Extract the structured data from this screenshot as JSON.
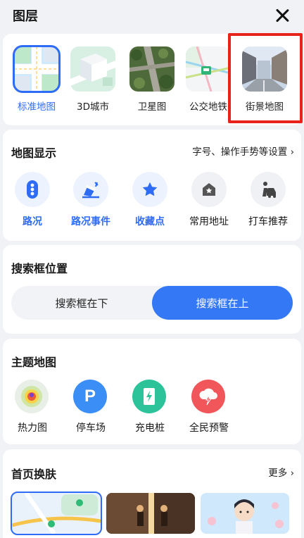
{
  "header": {
    "title": "图层"
  },
  "layers": [
    {
      "label": "标准地图",
      "icon": "standard-map-thumb",
      "selected": true
    },
    {
      "label": "3D城市",
      "icon": "3d-city-thumb"
    },
    {
      "label": "卫星图",
      "icon": "satellite-thumb"
    },
    {
      "label": "公交地铁",
      "icon": "transit-thumb"
    },
    {
      "label": "街景地图",
      "icon": "street-view-thumb",
      "highlighted": true
    }
  ],
  "map_display": {
    "title": "地图显示",
    "link": "字号、操作手势等设置 ›",
    "items": [
      {
        "label": "路况",
        "icon": "traffic-light-icon",
        "active": true
      },
      {
        "label": "路况事件",
        "icon": "road-event-icon",
        "active": true
      },
      {
        "label": "收藏点",
        "icon": "star-icon",
        "active": true
      },
      {
        "label": "常用地址",
        "icon": "home-icon",
        "active": false
      },
      {
        "label": "打车推荐",
        "icon": "taxi-person-icon",
        "active": false
      }
    ]
  },
  "search_position": {
    "title": "搜索框位置",
    "options": [
      "搜索框在下",
      "搜索框在上"
    ],
    "selected": "搜索框在上"
  },
  "theme_map": {
    "title": "主题地图",
    "items": [
      {
        "label": "热力图",
        "icon": "heatmap-icon",
        "color": "#e7efe6"
      },
      {
        "label": "停车场",
        "icon": "parking-icon",
        "color": "#3a8ef6"
      },
      {
        "label": "充电桩",
        "icon": "charging-icon",
        "color": "#2cc39a"
      },
      {
        "label": "全民预警",
        "icon": "warning-cloud-icon",
        "color": "#f0565a"
      }
    ]
  },
  "skins": {
    "title": "首页换肤",
    "more": "更多 ›",
    "items": [
      {
        "name": "map-skin",
        "selected": true
      },
      {
        "name": "photo-skin"
      },
      {
        "name": "cartoon-skin"
      }
    ]
  },
  "colors": {
    "accent": "#2f6cf6",
    "highlight": "#e8231b"
  }
}
